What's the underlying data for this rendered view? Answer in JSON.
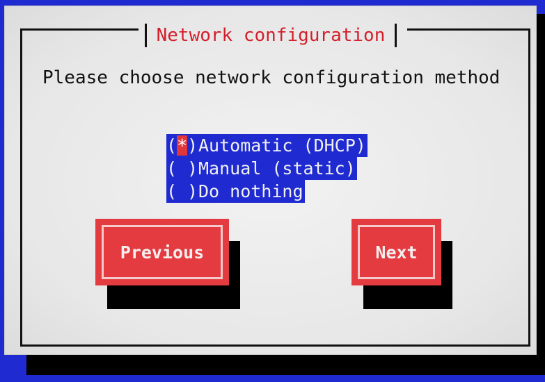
{
  "dialog": {
    "title": "Network configuration",
    "prompt": "Please choose network configuration method"
  },
  "options": [
    {
      "marker": "(*)",
      "label": "Automatic (DHCP)",
      "selected": true
    },
    {
      "marker": "( )",
      "label": "Manual (static)",
      "selected": false
    },
    {
      "marker": "( )",
      "label": "Do nothing",
      "selected": false
    }
  ],
  "buttons": {
    "previous_label": "Previous",
    "next_label": "Next"
  },
  "colors": {
    "background": "#1f2bd0",
    "title": "#d41f2b",
    "button": "#e43b40",
    "highlight": "#1f2bd0"
  }
}
